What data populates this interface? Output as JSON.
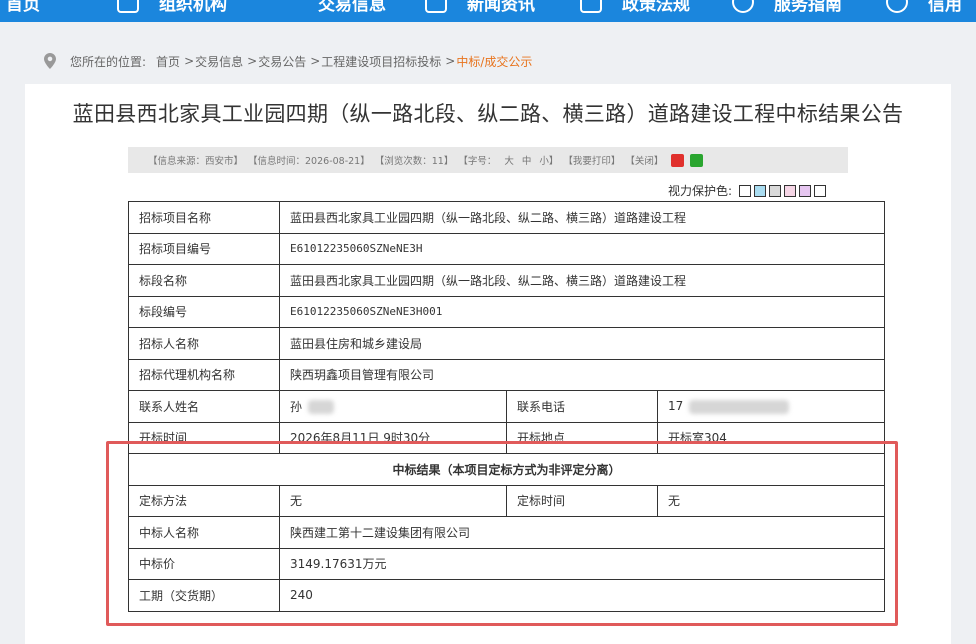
{
  "nav": {
    "items": [
      {
        "label": "首页",
        "icon": "home-icon"
      },
      {
        "label": "组织机构",
        "icon": "org-icon"
      },
      {
        "label": "交易信息",
        "icon": "trade-icon"
      },
      {
        "label": "新闻资讯",
        "icon": "news-icon"
      },
      {
        "label": "政策法规",
        "icon": "policy-icon"
      },
      {
        "label": "服务指南",
        "icon": "guide-icon"
      },
      {
        "label": "信用",
        "icon": "credit-icon"
      }
    ]
  },
  "breadcrumb": {
    "prefix": "您所在的位置:",
    "items": [
      "首页",
      "交易信息",
      "交易公告",
      "工程建设项目招标投标"
    ],
    "current": "中标/成交公示",
    "separator": ">"
  },
  "title": "蓝田县西北家具工业园四期（纵一路北段、纵二路、横三路）道路建设工程中标结果公告",
  "infobar": {
    "source": "【信息来源：西安市】",
    "time": "【信息时间：2026-08-21】",
    "views": "【浏览次数：11】",
    "font_label": "【字号：",
    "font_large": "大",
    "font_medium": "中",
    "font_small": "小】",
    "print": "【我要打印】",
    "close": "【关闭】"
  },
  "eyecare": {
    "label": "视力保护色:",
    "colors": [
      "#ffffff",
      "#a9dcf0",
      "#d9d9d9",
      "#f6d6e6",
      "#e6c6f0",
      "#ffffff"
    ]
  },
  "table": {
    "rows": [
      {
        "label": "招标项目名称",
        "value": "蓝田县西北家具工业园四期（纵一路北段、纵二路、横三路）道路建设工程"
      },
      {
        "label": "招标项目编号",
        "value": "E61012235060SZNeNE3H"
      },
      {
        "label": "标段名称",
        "value": "蓝田县西北家具工业园四期（纵一路北段、纵二路、横三路）道路建设工程"
      },
      {
        "label": "标段编号",
        "value": "E61012235060SZNeNE3H001"
      },
      {
        "label": "招标人名称",
        "value": "蓝田县住房和城乡建设局"
      },
      {
        "label": "招标代理机构名称",
        "value": "陕西玥鑫项目管理有限公司"
      }
    ],
    "contact": {
      "label": "联系人姓名",
      "value": "孙",
      "phone_label": "联系电话",
      "phone_value": "17"
    },
    "opening": {
      "label": "开标时间",
      "value": "2026年8月11日 9时30分",
      "place_label": "开标地点",
      "place_value": "开标室304"
    },
    "result_header": "中标结果（本项目定标方式为非评定分离）",
    "method": {
      "label": "定标方法",
      "value": "无",
      "time_label": "定标时间",
      "time_value": "无"
    },
    "winner": {
      "label": "中标人名称",
      "value": "陕西建工第十二建设集团有限公司"
    },
    "price": {
      "label": "中标价",
      "value": "3149.17631万元"
    },
    "period": {
      "label": "工期（交货期）",
      "value": "240"
    }
  },
  "colors": {
    "nav_bg": "#1b86dd",
    "accent": "#e8741e",
    "highlight": "#e05a5a"
  }
}
